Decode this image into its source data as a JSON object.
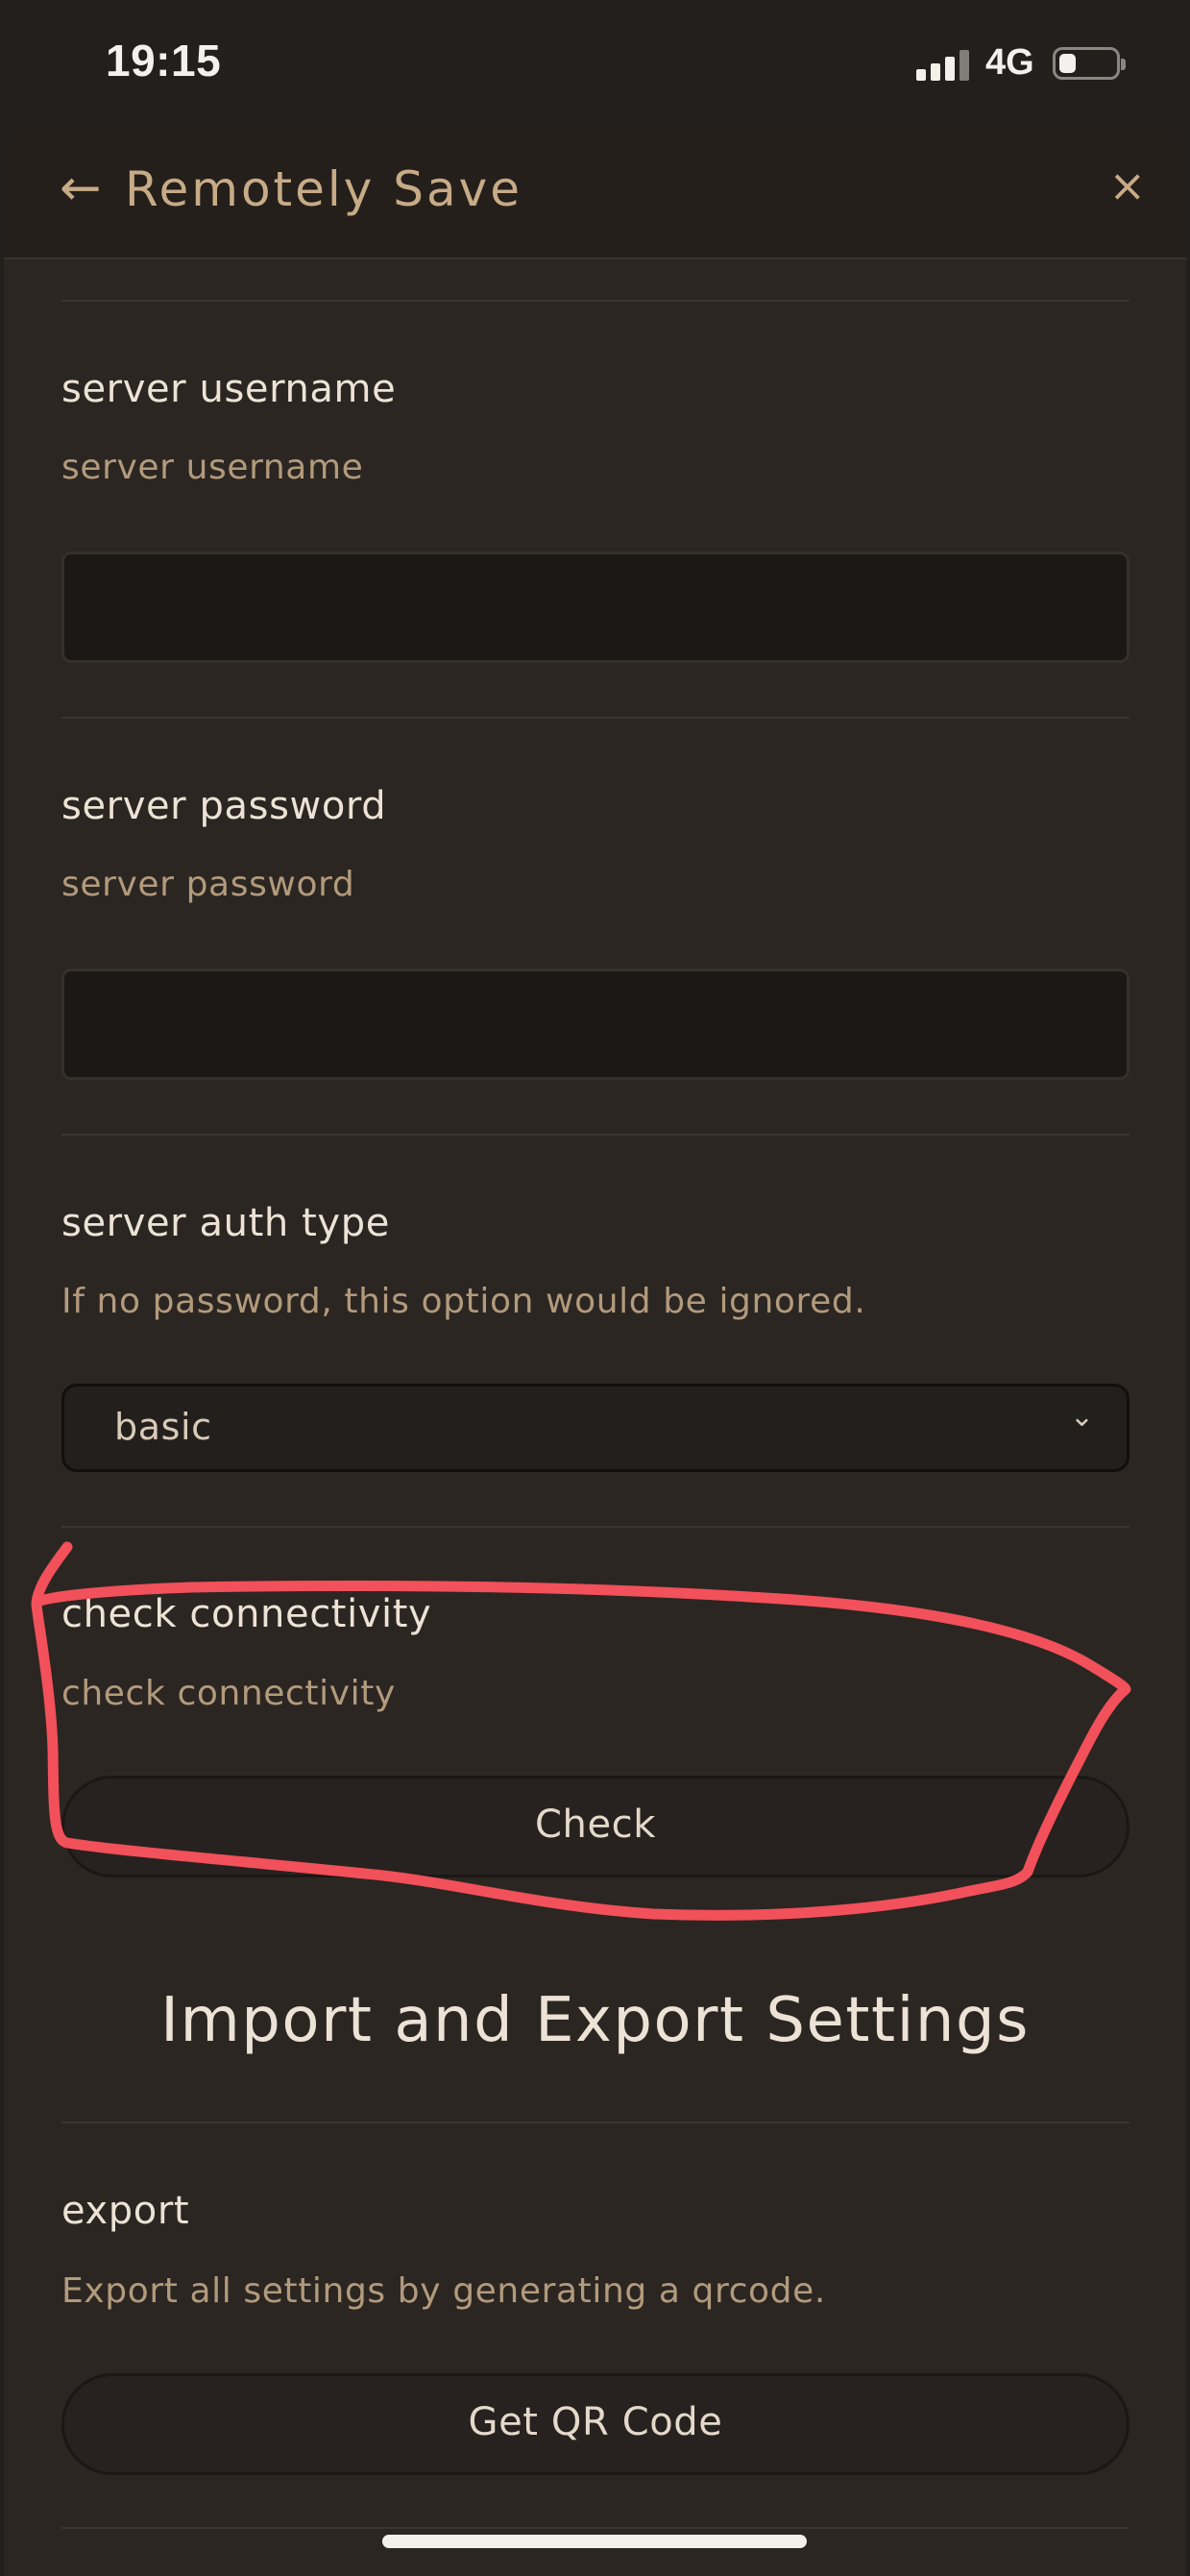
{
  "status_bar": {
    "time": "19:15",
    "network": "4G",
    "battery_level": 0.3
  },
  "header": {
    "back_icon": "←",
    "title": "Remotely Save",
    "close_icon": "×"
  },
  "settings": [
    {
      "name": "server username",
      "description": "server username",
      "input_value": ""
    },
    {
      "name": "server password",
      "description": "server password",
      "input_value": ""
    },
    {
      "name": "server auth type",
      "description": "If no password, this option would be ignored.",
      "selected": "basic"
    },
    {
      "name": "check connectivity",
      "description": "check connectivity",
      "button_label": "Check"
    }
  ],
  "import_export": {
    "heading": "Import and Export Settings",
    "export": {
      "name": "export",
      "description": "Export all settings by generating a qrcode.",
      "button_label": "Get QR Code"
    }
  },
  "colors": {
    "background": "#221f1c",
    "panel": "#2b2622",
    "accent": "#c7ab87",
    "annotation": "#f2505a"
  },
  "icons": {
    "back": "arrow-left-icon",
    "close": "close-icon",
    "dropdown": "chevron-down-icon"
  }
}
